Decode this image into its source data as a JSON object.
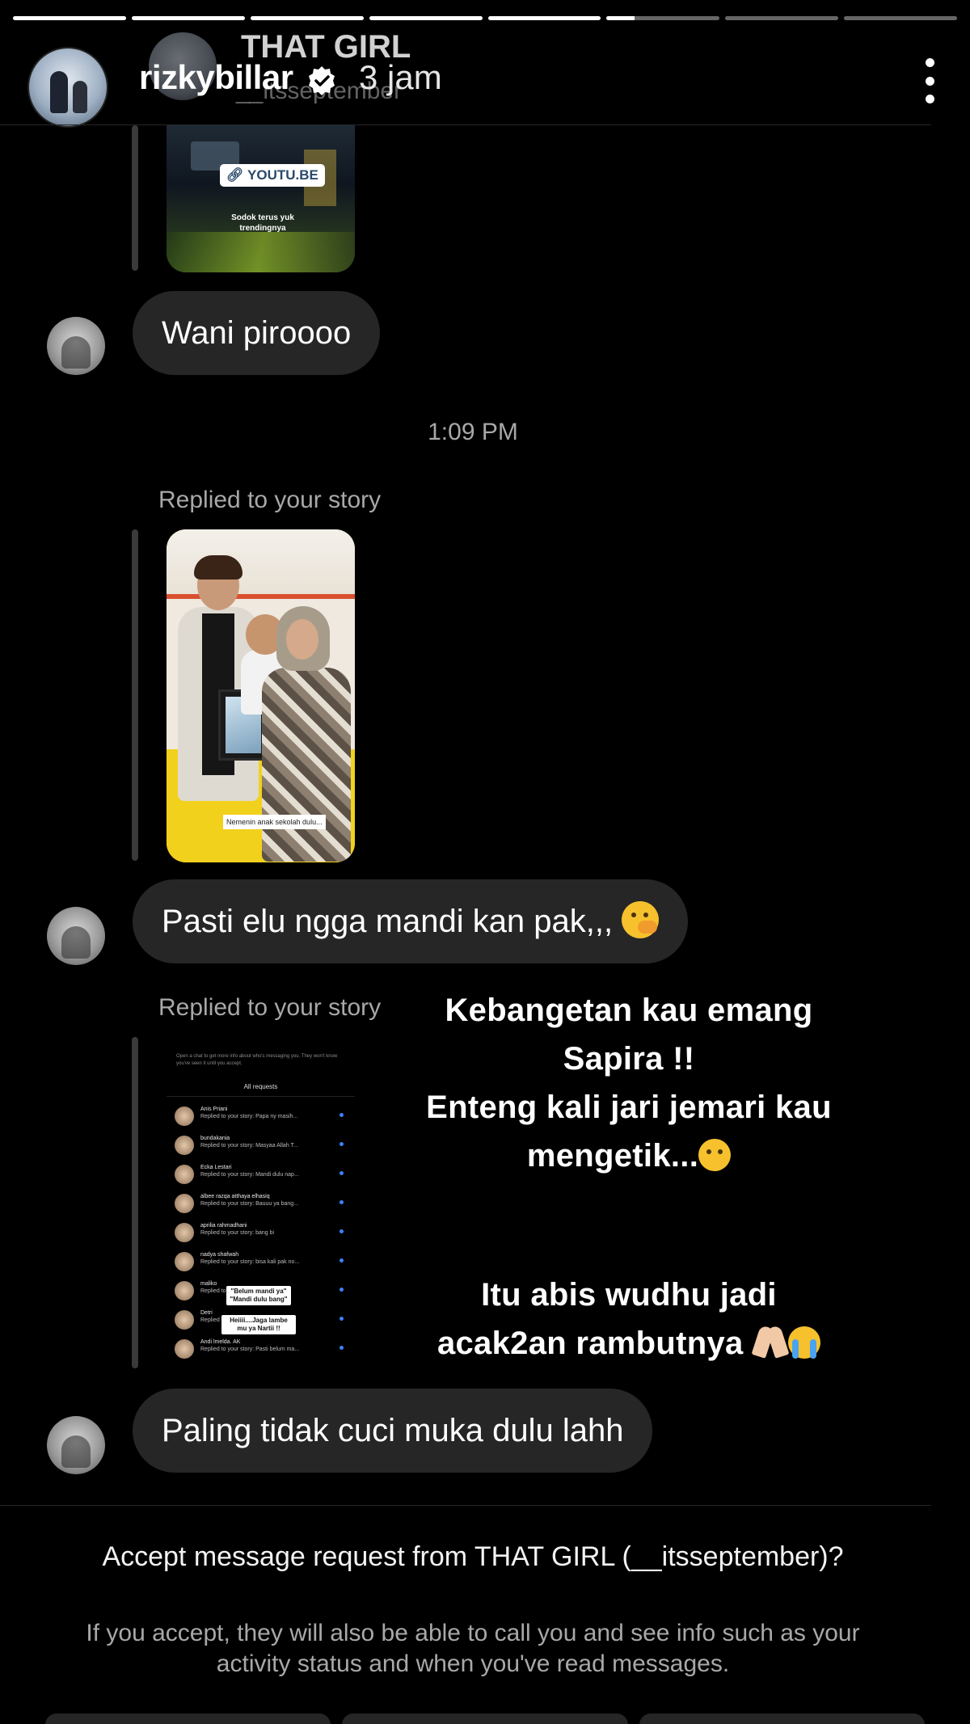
{
  "story": {
    "progress_segments": [
      1,
      1,
      1,
      1,
      1,
      0.25,
      0,
      0
    ],
    "username": "rizkybillar",
    "time_ago": "3 jam",
    "overlay_lines": [
      "Kebangetan kau emang",
      "Sapira !!",
      "Enteng kali jari jemari kau",
      "mengetik...",
      "",
      "Itu abis wudhu jadi",
      "acak2an rambutnya"
    ]
  },
  "dm": {
    "title": "THAT GIRL",
    "handle": "__itsseptember",
    "youtube_chip": "YOUTU.BE",
    "youtube_caption": "Sodok terus yuk trendingnya",
    "messages": [
      "Wani piroooo",
      "Pasti elu ngga mandi kan pak,,,",
      "Paling tidak cuci muka dulu lahh"
    ],
    "timestamp": "1:09 PM",
    "replied_label": "Replied to your story",
    "family_caption": "Nemenin anak sekolah dulu...",
    "requests_screenshot": {
      "header": "All requests",
      "top_note": "Open a chat to get more info about who's messaging you. They won't know you've seen it until you accept.",
      "rows": [
        {
          "name": "Anis Priani",
          "msg": "Replied to your story: Papa ny masih..."
        },
        {
          "name": "bundakania",
          "msg": "Replied to your story: Masyaa Allah T..."
        },
        {
          "name": "Ecka Lestari",
          "msg": "Replied to your story: Mandi dulu nap..."
        },
        {
          "name": "albee razqa atthaya elhasiq",
          "msg": "Replied to your story: Bauuu ya bang..."
        },
        {
          "name": "aprilia rahmadhani",
          "msg": "Replied to your story: bang bi"
        },
        {
          "name": "nadya shafwah",
          "msg": "Replied to your story: bisa kali pak no..."
        },
        {
          "name": "maliko",
          "msg": "Replied to your story"
        },
        {
          "name": "Detri",
          "msg": "Replied to your story"
        },
        {
          "name": "Andi lmelda. AK",
          "msg": "Replied to your story: Pasti belum ma..."
        }
      ],
      "sticker_1": "\"Belum mandi ya\" \"Mandi dulu bang\"",
      "sticker_2": "Heiiii....Jaga lambe mu ya Nartii !!"
    },
    "accept_title": "Accept message request from THAT GIRL (__itsseptember)?",
    "accept_desc": "If you accept, they will also be able to call you and see info such as your activity status and when you've read messages."
  },
  "colors": {
    "background": "#000000",
    "bubble": "#262626",
    "muted_text": "#a8a8a8",
    "verified": "#ffffff"
  },
  "icons": [
    "verified-badge-icon",
    "more-options-icon",
    "link-icon",
    "pleading-hand-over-mouth-emoji",
    "raised-eyebrow-emoji",
    "folded-hands-emoji",
    "loudly-crying-emoji"
  ]
}
